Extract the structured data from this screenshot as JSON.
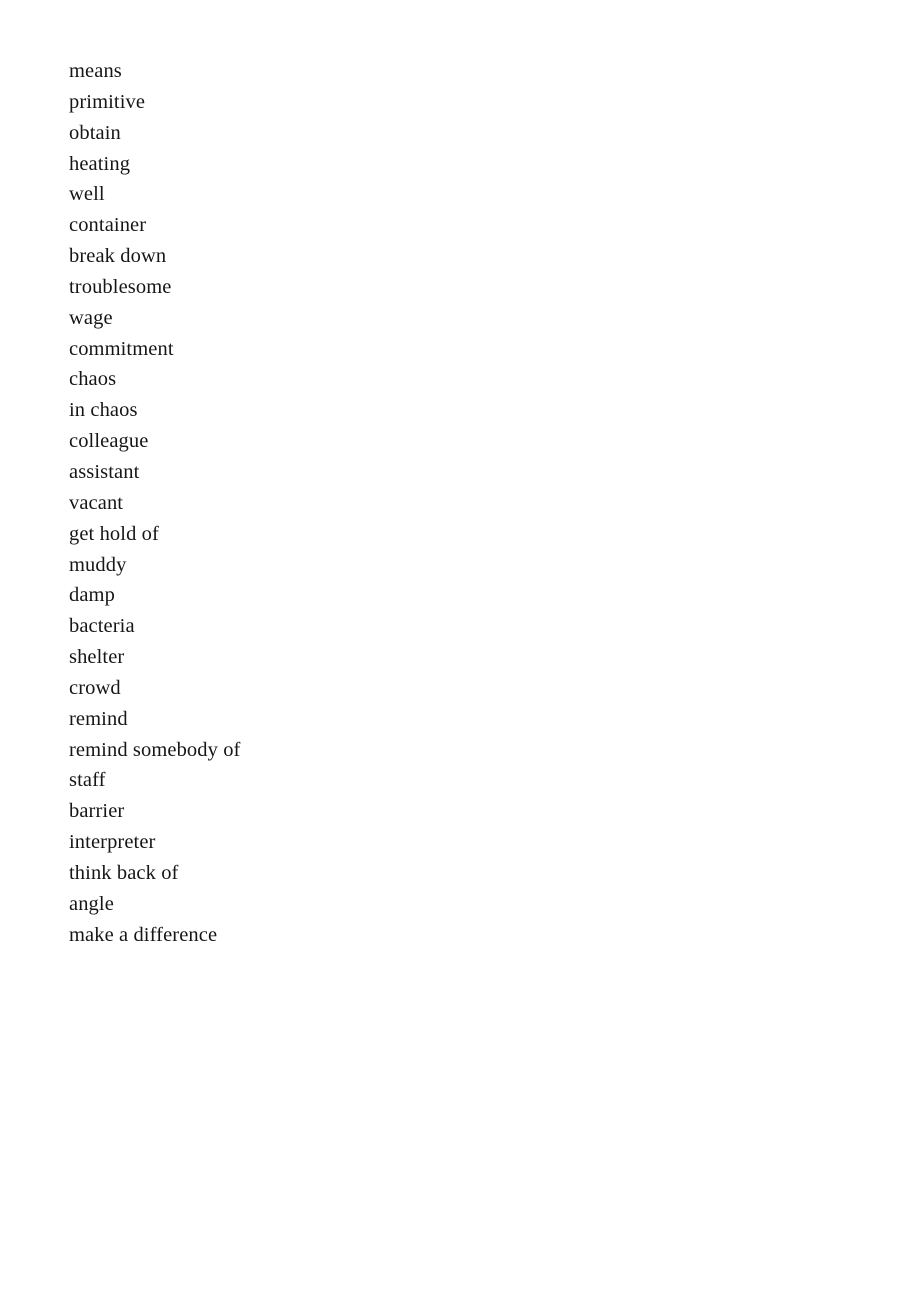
{
  "document": {
    "type": "vocabulary-word-list",
    "page_background": "#ffffff",
    "text_color": "#161616",
    "columns": 1,
    "entry_count": 29,
    "entries": [
      "means",
      "primitive",
      "obtain",
      "heating",
      "well",
      "container",
      "break down",
      "troublesome",
      "wage",
      "commitment",
      "chaos",
      "in chaos",
      "colleague",
      "assistant",
      "vacant",
      "get hold of",
      "muddy",
      "damp",
      "bacteria",
      "shelter",
      "crowd",
      "remind",
      "remind somebody of",
      "staff",
      "barrier",
      "interpreter",
      "think back of",
      "angle",
      "make a difference"
    ]
  }
}
